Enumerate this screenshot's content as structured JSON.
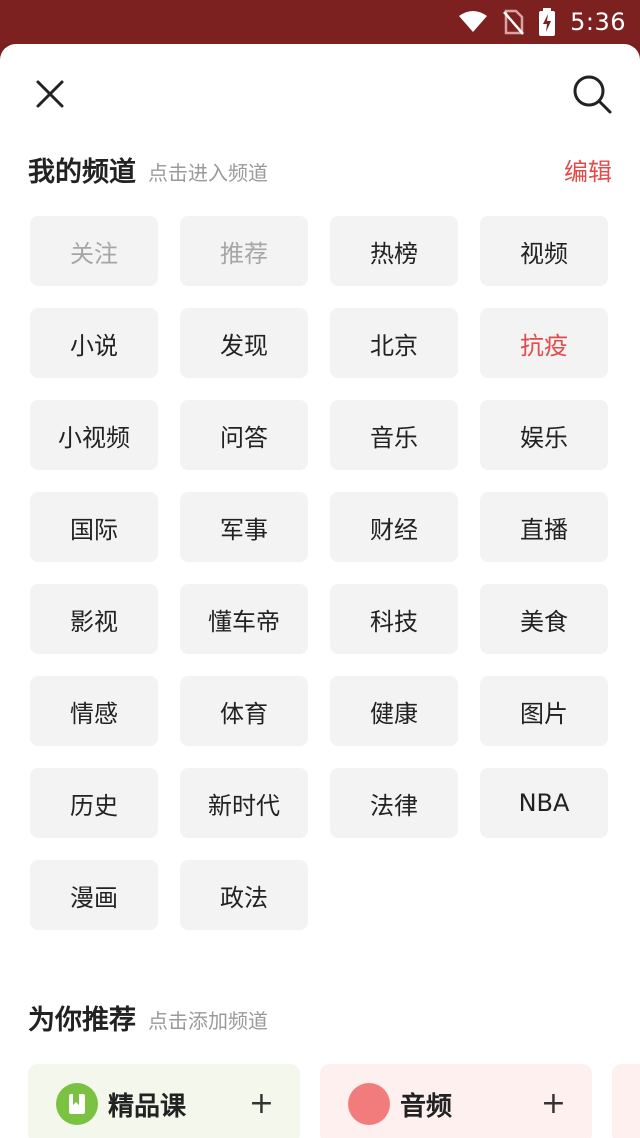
{
  "status_bar": {
    "time": "5:36"
  },
  "my_channels": {
    "title": "我的频道",
    "hint": "点击进入频道",
    "edit_label": "编辑",
    "channels": [
      {
        "label": "关注",
        "state": "fixed"
      },
      {
        "label": "推荐",
        "state": "fixed"
      },
      {
        "label": "热榜",
        "state": "normal"
      },
      {
        "label": "视频",
        "state": "normal"
      },
      {
        "label": "小说",
        "state": "normal"
      },
      {
        "label": "发现",
        "state": "normal"
      },
      {
        "label": "北京",
        "state": "normal"
      },
      {
        "label": "抗疫",
        "state": "active"
      },
      {
        "label": "小视频",
        "state": "normal"
      },
      {
        "label": "问答",
        "state": "normal"
      },
      {
        "label": "音乐",
        "state": "normal"
      },
      {
        "label": "娱乐",
        "state": "normal"
      },
      {
        "label": "国际",
        "state": "normal"
      },
      {
        "label": "军事",
        "state": "normal"
      },
      {
        "label": "财经",
        "state": "normal"
      },
      {
        "label": "直播",
        "state": "normal"
      },
      {
        "label": "影视",
        "state": "normal"
      },
      {
        "label": "懂车帝",
        "state": "normal"
      },
      {
        "label": "科技",
        "state": "normal"
      },
      {
        "label": "美食",
        "state": "normal"
      },
      {
        "label": "情感",
        "state": "normal"
      },
      {
        "label": "体育",
        "state": "normal"
      },
      {
        "label": "健康",
        "state": "normal"
      },
      {
        "label": "图片",
        "state": "normal"
      },
      {
        "label": "历史",
        "state": "normal"
      },
      {
        "label": "新时代",
        "state": "normal"
      },
      {
        "label": "法律",
        "state": "normal"
      },
      {
        "label": "NBA",
        "state": "normal"
      },
      {
        "label": "漫画",
        "state": "normal"
      },
      {
        "label": "政法",
        "state": "normal"
      }
    ]
  },
  "recommended": {
    "title": "为你推荐",
    "hint": "点击添加频道",
    "cards": [
      {
        "label": "精品课",
        "icon": "bookmark-icon",
        "icon_color": "#7cc242",
        "bg_color": "#f4f8ec"
      },
      {
        "label": "音频",
        "icon": "audio-icon",
        "icon_color": "#f27c7c",
        "bg_color": "#fdf0ef"
      }
    ],
    "plus_label": "+"
  },
  "colors": {
    "accent": "#e34b4b",
    "status_bar": "#7d2020"
  }
}
